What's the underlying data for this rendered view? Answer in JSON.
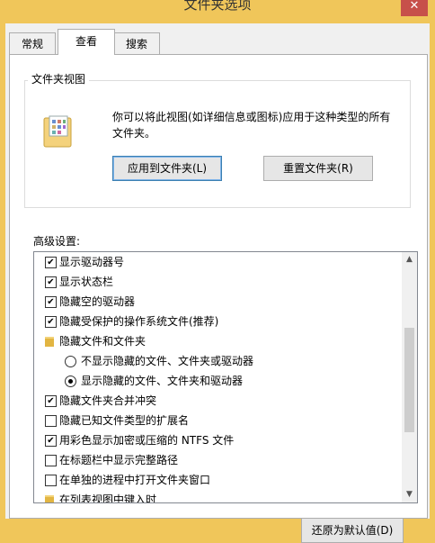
{
  "window": {
    "title": "文件夹选项",
    "close_symbol": "✕"
  },
  "tabs": [
    {
      "label": "常规",
      "active": false
    },
    {
      "label": "查看",
      "active": true
    },
    {
      "label": "搜索",
      "active": false
    }
  ],
  "folder_views": {
    "group_label": "文件夹视图",
    "description": "你可以将此视图(如详细信息或图标)应用于这种类型的所有文件夹。",
    "apply_button": "应用到文件夹(L)",
    "reset_button": "重置文件夹(R)"
  },
  "advanced": {
    "label": "高级设置:",
    "items": [
      {
        "kind": "checkbox",
        "checked": true,
        "label": "显示驱动器号"
      },
      {
        "kind": "checkbox",
        "checked": true,
        "label": "显示状态栏"
      },
      {
        "kind": "checkbox",
        "checked": true,
        "label": "隐藏空的驱动器"
      },
      {
        "kind": "checkbox",
        "checked": true,
        "label": "隐藏受保护的操作系统文件(推荐)"
      },
      {
        "kind": "folder",
        "label": "隐藏文件和文件夹"
      },
      {
        "kind": "radio",
        "checked": false,
        "label": "不显示隐藏的文件、文件夹或驱动器"
      },
      {
        "kind": "radio",
        "checked": true,
        "label": "显示隐藏的文件、文件夹和驱动器"
      },
      {
        "kind": "checkbox",
        "checked": true,
        "label": "隐藏文件夹合并冲突"
      },
      {
        "kind": "checkbox",
        "checked": false,
        "label": "隐藏已知文件类型的扩展名"
      },
      {
        "kind": "checkbox",
        "checked": true,
        "label": "用彩色显示加密或压缩的 NTFS 文件"
      },
      {
        "kind": "checkbox",
        "checked": false,
        "label": "在标题栏中显示完整路径"
      },
      {
        "kind": "checkbox",
        "checked": false,
        "label": "在单独的进程中打开文件夹窗口"
      },
      {
        "kind": "folder",
        "label": "在列表视图中键入时"
      }
    ]
  },
  "restore_button": "还原为默认值(D)"
}
